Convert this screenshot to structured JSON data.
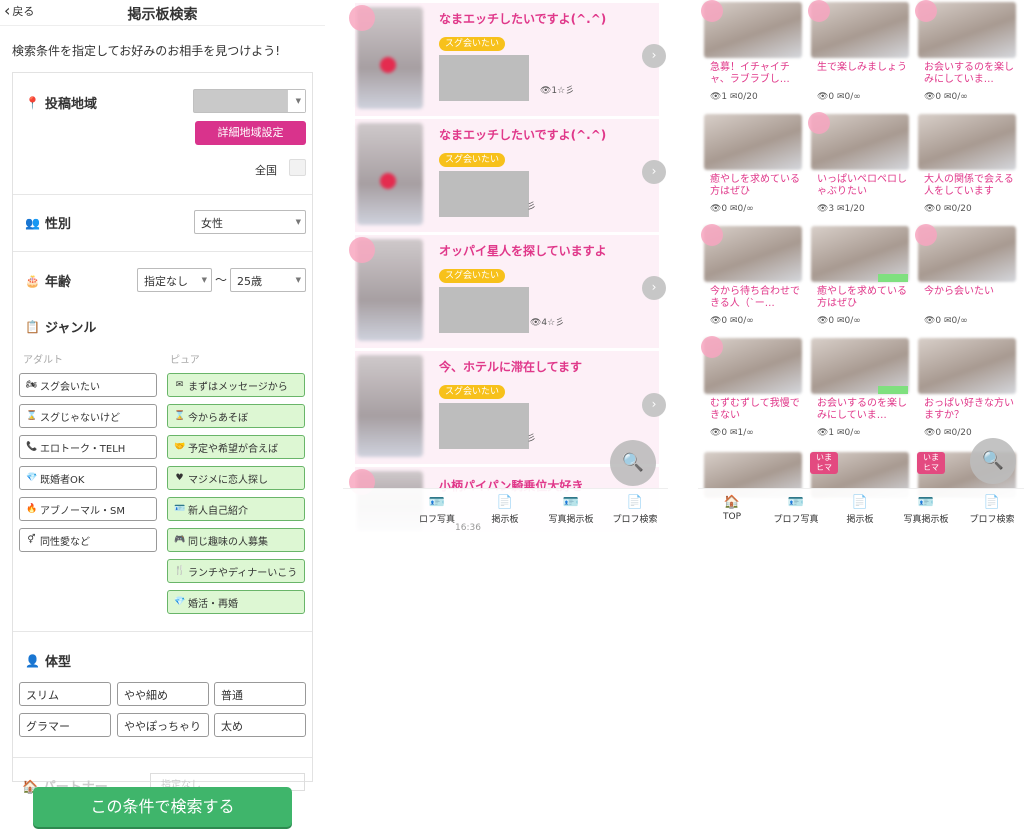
{
  "left": {
    "back_label": "戻る",
    "title": "掲示板検索",
    "intro": "検索条件を指定してお好みのお相手を見つけよう!",
    "region": {
      "label": "投稿地域",
      "detail_button": "詳細地域設定",
      "nationwide": "全国"
    },
    "gender": {
      "label": "性別",
      "value": "女性"
    },
    "age": {
      "label": "年齢",
      "from": "指定なし",
      "to": "25歳",
      "sep": "〜"
    },
    "genre": {
      "label": "ジャンル",
      "adult_caption": "アダルト",
      "pure_caption": "ピュア",
      "adult": [
        "スグ会いたい",
        "スグじゃないけど",
        "エロトーク・TELH",
        "既婚者OK",
        "アブノーマル・SM",
        "同性愛など"
      ],
      "pure": [
        "まずはメッセージから",
        "今からあそぼ",
        "予定や希望が合えば",
        "マジメに恋人探し",
        "新人自己紹介",
        "同じ趣味の人募集",
        "ランチやディナーいこう",
        "婚活・再婚"
      ]
    },
    "body_type": {
      "label": "体型",
      "options": [
        "スリム",
        "やや細め",
        "普通",
        "グラマー",
        "ややぽっちゃり",
        "太め"
      ]
    },
    "partner_label": "パートナー",
    "partner_value": "指定なし",
    "search_button": "この条件で検索する"
  },
  "middle": {
    "posts": [
      {
        "title": "なまエッチしたいですよ(^.^)",
        "chip": "スグ会いたい",
        "stats": "👁1☆彡"
      },
      {
        "title": "なまエッチしたいですよ(^.^)",
        "chip": "スグ会いたい",
        "stats": "彡"
      },
      {
        "title": "オッパイ星人を探していますよ",
        "chip": "スグ会いたい",
        "stats": "👁4☆彡"
      },
      {
        "title": "今、ホテルに滞在してます",
        "chip": "スグ会いたい",
        "stats": "彡"
      },
      {
        "title": "小柄パイパン騎乗位大好き",
        "chip": "",
        "stats": ""
      }
    ],
    "footer_time": "16:36",
    "nav": [
      "ロフ写真",
      "掲示板",
      "写真掲示板",
      "プロフ検索"
    ]
  },
  "right": {
    "cards": [
      {
        "title": "急募！イチャイチャ、ラブラブし…",
        "stats": "👁1 ✉0/20"
      },
      {
        "title": "生で楽しみましょう",
        "stats": "👁0 ✉0/∞"
      },
      {
        "title": "お会いするのを楽しみにしていま…",
        "stats": "👁0 ✉0/∞"
      },
      {
        "title": "癒やしを求めている方はぜひ",
        "stats": "👁0 ✉0/∞"
      },
      {
        "title": "いっぱいペロペロしゃぶりたい",
        "stats": "👁3 ✉1/20"
      },
      {
        "title": "大人の関係で会える人をしています",
        "stats": "👁0 ✉0/20"
      },
      {
        "title": "今から待ち合わせできる人（`ー…",
        "stats": "👁0 ✉0/∞"
      },
      {
        "title": "癒やしを求めている方はぜひ",
        "stats": "👁0 ✉0/∞"
      },
      {
        "title": "今から会いたい",
        "stats": "👁0 ✉0/∞"
      },
      {
        "title": "むずむずして我慢できない",
        "stats": "👁0 ✉1/∞"
      },
      {
        "title": "お会いするのを楽しみにしていま…",
        "stats": "👁1 ✉0/∞"
      },
      {
        "title": "おっぱい好きな方いますか？",
        "stats": "👁0 ✉0/20"
      }
    ],
    "ima_badge": "いま\nヒマ",
    "nav": [
      "TOP",
      "プロフ写真",
      "掲示板",
      "写真掲示板",
      "プロフ検索"
    ]
  },
  "colors": {
    "accent_pink": "#e0388a",
    "button_pink": "#d9338c",
    "search_green": "#3fb56b",
    "chip_orange": "#f7c11b",
    "tag_green": "#ddf7d3"
  }
}
